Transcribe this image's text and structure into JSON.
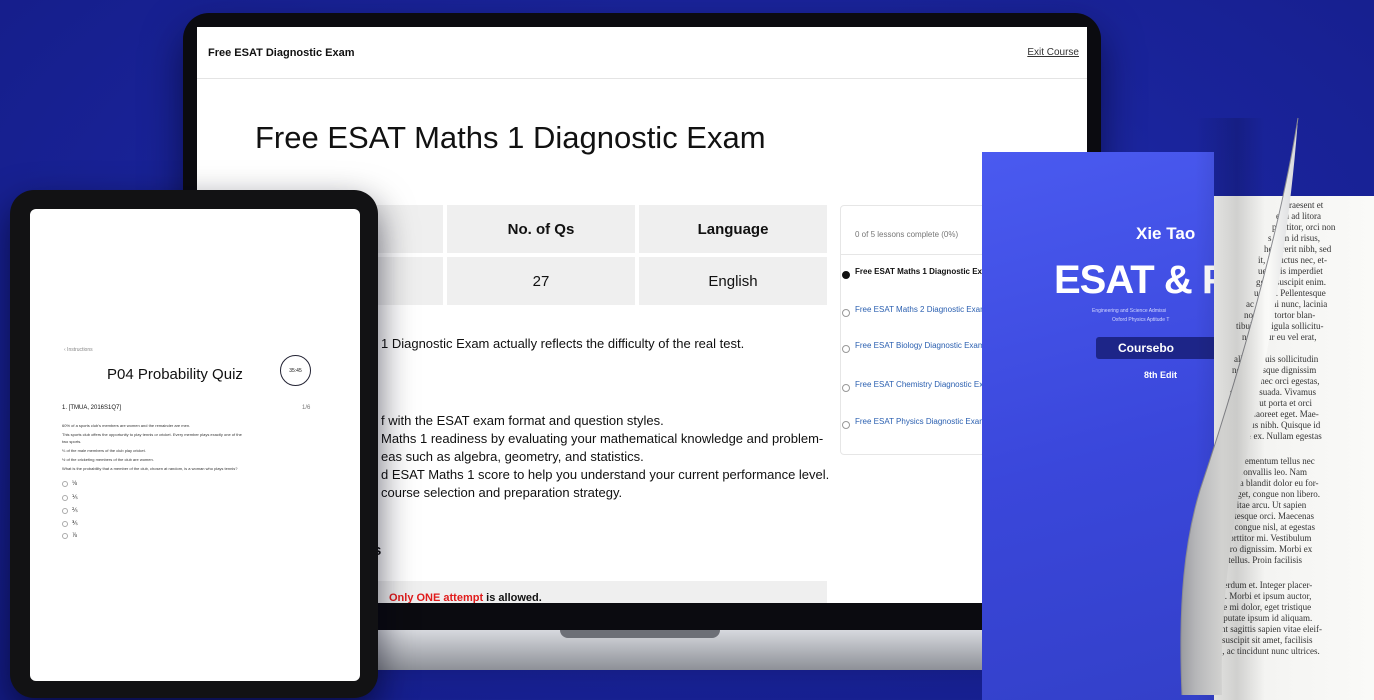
{
  "laptop": {
    "course_title": "Free ESAT Diagnostic Exam",
    "exit_link": "Exit Course",
    "page_title": "Free ESAT Maths 1 Diagnostic Exam",
    "info_table": {
      "headers": [
        "ed",
        "No. of Qs",
        "Language"
      ],
      "values": [
        "",
        "27",
        "English"
      ]
    },
    "description": "1 Diagnostic Exam actually reflects the difficulty of the real test.",
    "bullets": [
      "f with the ESAT exam format and question styles.",
      "Maths 1 readiness by evaluating your mathematical knowledge and problem-",
      "eas such as algebra, geometry, and statistics.",
      "d ESAT Maths 1 score to help you understand your current performance level.",
      "course selection and preparation strategy."
    ],
    "section_heading": "s",
    "rule": {
      "highlight": "Only ONE attempt",
      "rest": " is allowed."
    },
    "lessons": {
      "progress": "0 of 5 lessons complete (0%)",
      "items": [
        "Free ESAT Maths 1 Diagnostic Exam",
        "Free ESAT Maths 2 Diagnostic Exam",
        "Free ESAT Biology Diagnostic Exam",
        "Free ESAT Chemistry Diagnostic Exam",
        "Free ESAT Physics Diagnostic Exam"
      ]
    }
  },
  "tablet": {
    "back": "‹ Instructions",
    "title": "P04 Probability Quiz",
    "timer": "35:45",
    "question_header": "1. [TMUA, 2016S1Q7]",
    "question_number": "1/6",
    "question_lines": [
      "60% of a sports club's members are women and the remainder are men.",
      "This sports club offers the opportunity to play tennis or cricket. Every member plays exactly one of the",
      "two sports.",
      "⅔ of the male members of the club play cricket.",
      "½ of the cricketing members of the club are women.",
      "What is the probability that a member of the club, chosen at random, is a woman who plays tennis?"
    ],
    "options": [
      "⅛",
      "⅕",
      "⅖",
      "⅗",
      "⅞"
    ]
  },
  "book": {
    "author": "Xie Tao",
    "title": "ESAT & P",
    "subtitle_1": "Engineering and Science Admissi",
    "subtitle_2": "Oxford Physics Aptitude T",
    "tag": "Coursebo",
    "edition": "8th Edit",
    "page_lines": [
      "Praesent et",
      "equ ad litora",
      "porttitor, orci non",
      "s cum id risus,",
      "hendrerit nibh, sed",
      "it, in luctus nec, et-",
      "ue, quis imperdiet",
      "gget, suscipit enim.",
      "ue vel. Pellentesque",
      "ac vel mi nunc, lacinia",
      "non nec tortor blan-",
      "tibulales ligula sollicitu-",
      "nsectetur eu vel erat,",
      "",
      "allam. Duis sollicitudin",
      "nec. Quisque dignissim",
      "magna nec orci egestas,",
      "sst malesuada. Vivamus",
      "la diam, ut porta et orci",
      "vs ante laoreet eget. Mae-",
      "s rhoncus nibh. Quisque id",
      "e ornare ex. Nullam egestas",
      "",
      "istique elementum tellus nec",
      "rat ut, convallis leo. Nam",
      "In lacinia blandit dolor eu for-",
      "perdiet eget, congue non libero.",
      "retrum vitae arcu. Ut sapien",
      "nas pellentesque orci. Maecenas",
      "ullisse vel congue nisl, at egestas",
      "ltem ac, porttitor mi. Vestibulum",
      "ltrices libero dignissim. Morbi ex",
      "consequat tellus. Proin facilisis",
      "",
      "dunt dui interdum et. Integer placer-",
      "posuere nec. Morbi et ipsum auctor,",
      "ellus posuere mi dolor, eget tristique",
      "volutpat vulputate ipsum id aliquam.",
      "sum. Praesent sagittis sapien vitae eleif-",
      "convallis ut suscipit sit amet, facilisis",
      "orci facilisis, ac tincidunt nunc ultrices."
    ]
  }
}
